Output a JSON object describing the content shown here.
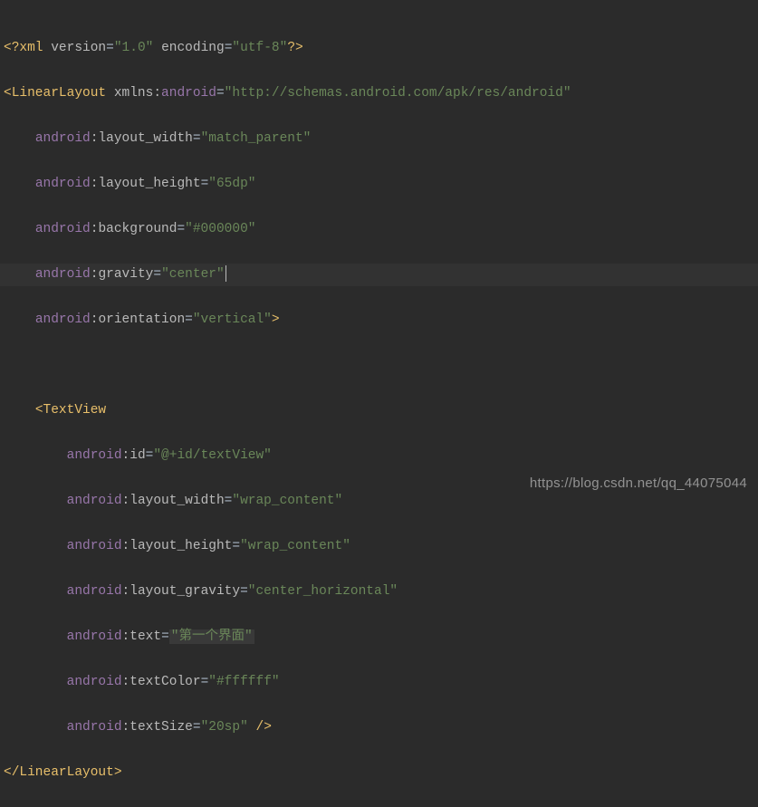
{
  "code": {
    "line1": {
      "open": "<?",
      "tag": "xml ",
      "a1": "version",
      "eq1": "=",
      "v1": "\"1.0\"",
      "sp": " ",
      "a2": "encoding",
      "eq2": "=",
      "v2": "\"utf-8\"",
      "close": "?>"
    },
    "line2": {
      "open": "<",
      "tag": "LinearLayout ",
      "a1": "xmlns:",
      "ns": "android",
      "eq": "=",
      "val": "\"http://schemas.android.com/apk/res/android\""
    },
    "line3": {
      "indent": "    ",
      "ns": "android",
      "colon": ":",
      "attr": "layout_width",
      "eq": "=",
      "val": "\"match_parent\""
    },
    "line4": {
      "indent": "    ",
      "ns": "android",
      "colon": ":",
      "attr": "layout_height",
      "eq": "=",
      "val": "\"65dp\""
    },
    "line5": {
      "indent": "    ",
      "ns": "android",
      "colon": ":",
      "attr": "background",
      "eq": "=",
      "val": "\"#000000\""
    },
    "line6": {
      "indent": "    ",
      "ns": "android",
      "colon": ":",
      "attr": "gravity",
      "eq": "=",
      "val": "\"center\""
    },
    "line7": {
      "indent": "    ",
      "ns": "android",
      "colon": ":",
      "attr": "orientation",
      "eq": "=",
      "val": "\"vertical\"",
      "close": ">"
    },
    "line8": {
      "indent": "    ",
      "open": "<",
      "tag": "TextView"
    },
    "line9": {
      "indent": "        ",
      "ns": "android",
      "colon": ":",
      "attr": "id",
      "eq": "=",
      "val": "\"@+id/textView\""
    },
    "line10": {
      "indent": "        ",
      "ns": "android",
      "colon": ":",
      "attr": "layout_width",
      "eq": "=",
      "val": "\"wrap_content\""
    },
    "line11": {
      "indent": "        ",
      "ns": "android",
      "colon": ":",
      "attr": "layout_height",
      "eq": "=",
      "val": "\"wrap_content\""
    },
    "line12": {
      "indent": "        ",
      "ns": "android",
      "colon": ":",
      "attr": "layout_gravity",
      "eq": "=",
      "val": "\"center_horizontal\""
    },
    "line13": {
      "indent": "        ",
      "ns": "android",
      "colon": ":",
      "attr": "text",
      "eq": "=",
      "val": "\"第一个界面\""
    },
    "line14": {
      "indent": "        ",
      "ns": "android",
      "colon": ":",
      "attr": "textColor",
      "eq": "=",
      "val": "\"#ffffff\""
    },
    "line15": {
      "indent": "        ",
      "ns": "android",
      "colon": ":",
      "attr": "textSize",
      "eq": "=",
      "val": "\"20sp\"",
      "close": " />"
    },
    "line16": {
      "open": "</",
      "tag": "LinearLayout",
      "close": ">"
    }
  },
  "watermark": "https://blog.csdn.net/qq_44075044"
}
